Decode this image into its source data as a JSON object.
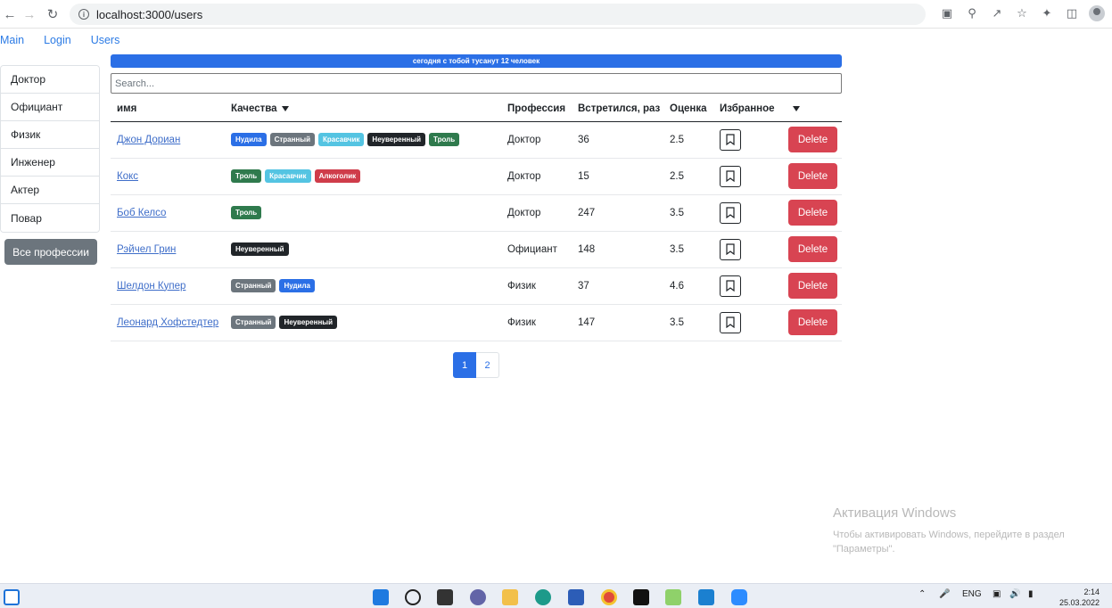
{
  "browser": {
    "url": "localhost:3000/users"
  },
  "nav": {
    "main": "Main",
    "login": "Login",
    "users": "Users"
  },
  "sidebar": {
    "professions": [
      "Доктор",
      "Официант",
      "Физик",
      "Инженер",
      "Актер",
      "Повар"
    ],
    "all_button": "Все профессии"
  },
  "banner": "сегодня с тобой тусанут 12 человек",
  "search": {
    "placeholder": "Search..."
  },
  "table": {
    "headers": {
      "name": "имя",
      "qualities": "Качества",
      "profession": "Профессия",
      "met": "Встретился, раз",
      "rating": "Оценка",
      "favorite": "Избранное"
    },
    "delete_label": "Delete",
    "rows": [
      {
        "name": "Джон Дориан",
        "qualities": [
          {
            "label": "Нудила",
            "color": "blue"
          },
          {
            "label": "Странный",
            "color": "grey"
          },
          {
            "label": "Красавчик",
            "color": "cyan"
          },
          {
            "label": "Неуверенный",
            "color": "dark"
          },
          {
            "label": "Троль",
            "color": "green"
          }
        ],
        "profession": "Доктор",
        "met": "36",
        "rating": "2.5"
      },
      {
        "name": "Кокс",
        "qualities": [
          {
            "label": "Троль",
            "color": "green"
          },
          {
            "label": "Красавчик",
            "color": "cyan"
          },
          {
            "label": "Алкоголик",
            "color": "red"
          }
        ],
        "profession": "Доктор",
        "met": "15",
        "rating": "2.5"
      },
      {
        "name": "Боб Келсо",
        "qualities": [
          {
            "label": "Троль",
            "color": "green"
          }
        ],
        "profession": "Доктор",
        "met": "247",
        "rating": "3.5"
      },
      {
        "name": "Рэйчел Грин",
        "qualities": [
          {
            "label": "Неуверенный",
            "color": "dark"
          }
        ],
        "profession": "Официант",
        "met": "148",
        "rating": "3.5"
      },
      {
        "name": "Шелдон Купер",
        "qualities": [
          {
            "label": "Странный",
            "color": "grey"
          },
          {
            "label": "Нудила",
            "color": "blue"
          }
        ],
        "profession": "Физик",
        "met": "37",
        "rating": "4.6"
      },
      {
        "name": "Леонард Хофстедтер",
        "qualities": [
          {
            "label": "Странный",
            "color": "grey"
          },
          {
            "label": "Неуверенный",
            "color": "dark"
          }
        ],
        "profession": "Физик",
        "met": "147",
        "rating": "3.5"
      }
    ]
  },
  "pagination": {
    "pages": [
      "1",
      "2"
    ],
    "active": "1"
  },
  "watermark": {
    "title": "Активация Windows",
    "line1": "Чтобы активировать Windows, перейдите в раздел",
    "line2": "\"Параметры\"."
  },
  "taskbar": {
    "lang": "ENG",
    "time": "2:14",
    "date": "25.03.2022"
  },
  "colors": {
    "primary": "#2b6fe6",
    "danger": "#d84452",
    "secondary": "#6c757d"
  }
}
